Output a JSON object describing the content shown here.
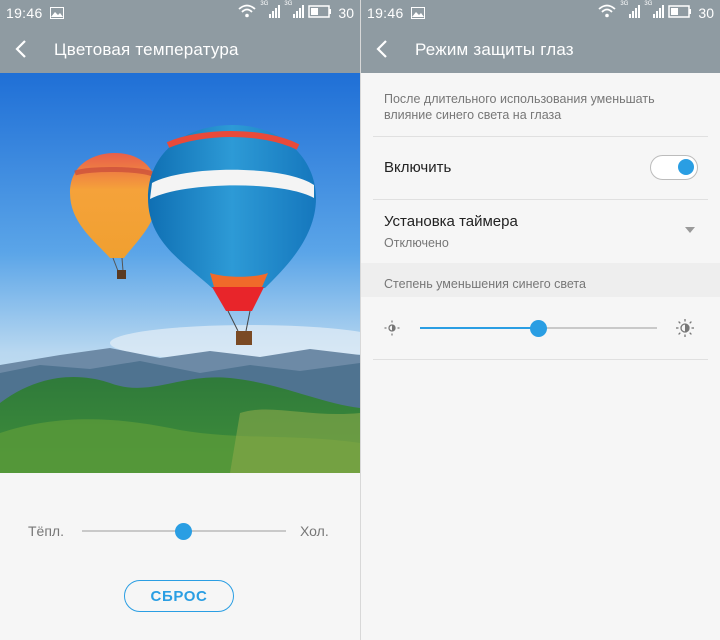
{
  "status": {
    "time": "19:46",
    "net1": "3G",
    "net2": "3G",
    "battery": "30"
  },
  "left": {
    "title": "Цветовая температура",
    "warm_label": "Тёпл.",
    "cold_label": "Хол.",
    "temperature_level": 0.5,
    "reset_label": "СБРОС"
  },
  "right": {
    "title": "Режим защиты глаз",
    "description": "После длительного использования уменьшать влияние синего света на глаза",
    "enable_label": "Включить",
    "enable_on": true,
    "timer_label": "Установка таймера",
    "timer_value": "Отключено",
    "section_label": "Степень уменьшения синего света",
    "reduction_level": 0.5
  },
  "colors": {
    "accent": "#2a9ee3",
    "appbar": "#8f9ba2"
  },
  "icons": [
    "back-arrow-icon",
    "picture-icon",
    "wifi-icon",
    "signal-icon",
    "battery-icon",
    "dropdown-arrow-icon",
    "sun-low-icon",
    "sun-high-icon"
  ]
}
